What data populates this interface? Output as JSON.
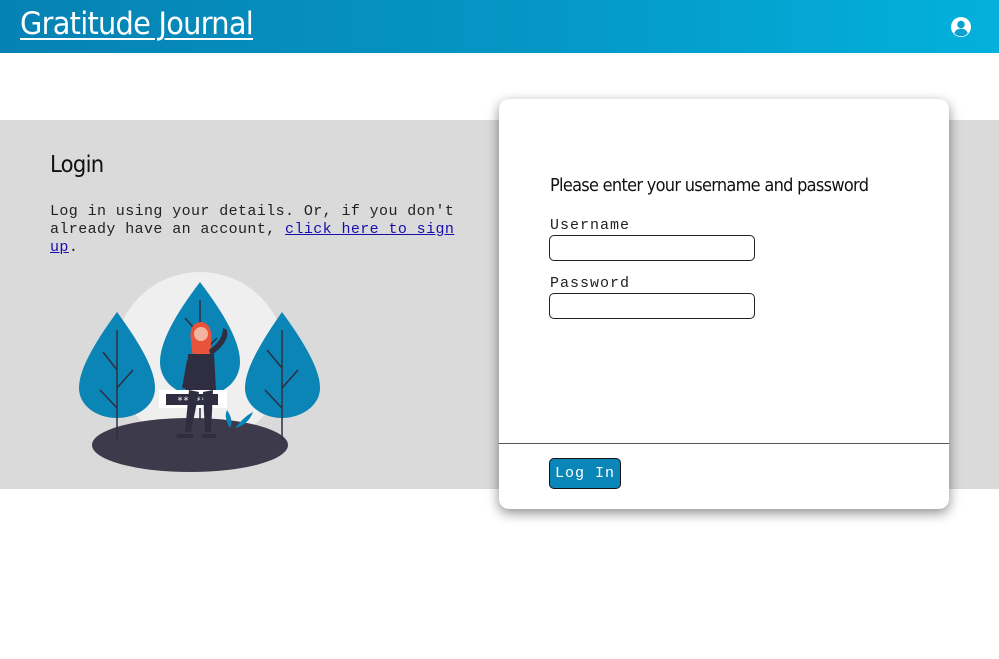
{
  "header": {
    "title": "Gratitude Journal",
    "account_icon": "user-circle-icon"
  },
  "intro": {
    "title": "Login",
    "text_before": "Log in using your details. Or, if you don't already have an account, ",
    "link_text": "click here to sign up",
    "text_after": ".",
    "illustration_text": "*****"
  },
  "form": {
    "heading": "Please enter your username and password",
    "username_label": "Username",
    "username_value": "",
    "password_label": "Password",
    "password_value": "",
    "submit_label": "Log In"
  },
  "colors": {
    "header_start": "#0582b3",
    "header_end": "#03b1dc",
    "band": "#dadada",
    "accent": "#0a87b8",
    "link": "#1a0dab"
  }
}
